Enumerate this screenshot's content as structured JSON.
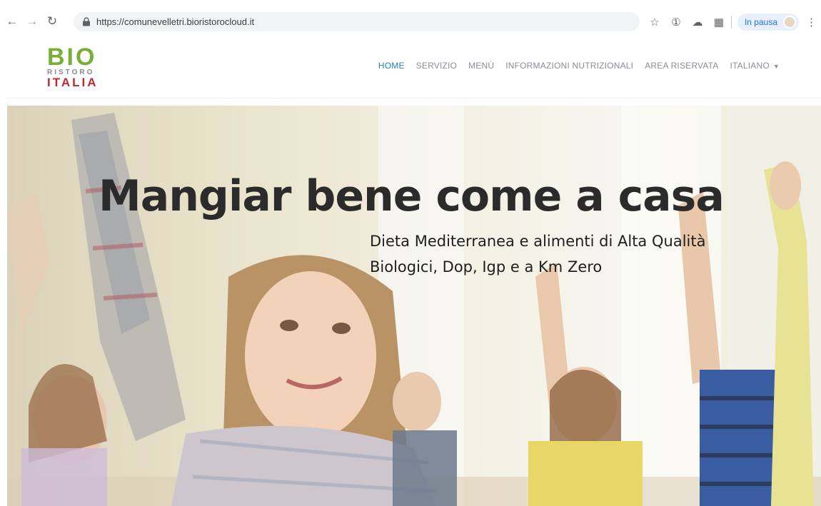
{
  "browser": {
    "url": "https://comunevelletri.bioristorocloud.it",
    "profile_status": "In pausa",
    "icons": [
      "back-arrow-icon",
      "forward-arrow-icon",
      "reload-icon",
      "lock-icon",
      "star-icon",
      "extension-icon",
      "cloud-icon",
      "cast-icon",
      "avatar",
      "kebab-menu-icon"
    ]
  },
  "site": {
    "logo": {
      "line1": "BIO",
      "line2": "RISTORO",
      "line3": "ITALIA"
    },
    "nav": [
      {
        "label": "HOME",
        "active": true
      },
      {
        "label": "SERVIZIO",
        "active": false
      },
      {
        "label": "MENÙ",
        "active": false
      },
      {
        "label": "INFORMAZIONI NUTRIZIONALI",
        "active": false
      },
      {
        "label": "AREA RISERVATA",
        "active": false
      },
      {
        "label": "ITALIANO",
        "active": false,
        "dropdown": true
      }
    ],
    "colors": {
      "active_nav": "#2a7fc1",
      "logo_green": "#7aae3b",
      "logo_red": "#c1272d"
    }
  },
  "hero": {
    "title": "Mangiar bene come a casa",
    "subtitle_line1": "Dieta Mediterranea e alimenti di Alta Qualità",
    "subtitle_line2": "Biologici, Dop, Igp e a Km Zero"
  }
}
